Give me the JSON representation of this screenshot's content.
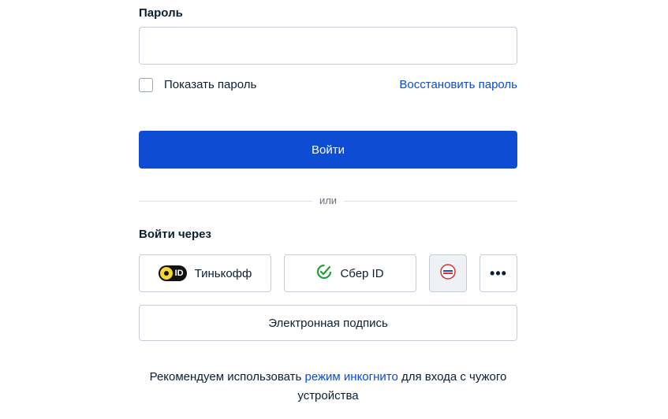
{
  "password": {
    "label": "Пароль",
    "value": "",
    "placeholder": ""
  },
  "show_password": {
    "label": "Показать пароль",
    "checked": false
  },
  "restore_link": "Восстановить пароль",
  "login_button": "Войти",
  "divider_text": "или",
  "login_via": {
    "title": "Войти через",
    "buttons": [
      {
        "label": "Тинькофф",
        "badge": "ID",
        "icon": "tinkoff-id-icon"
      },
      {
        "label": "Сбер ID",
        "icon": "sber-icon"
      },
      {
        "label": "",
        "icon": "gosuslugi-icon"
      },
      {
        "label": "•••",
        "icon": "more-icon"
      }
    ]
  },
  "esign_button": "Электронная подпись",
  "recommendation": {
    "before": "Рекомендуем использовать ",
    "link": "режим инкогнито",
    "after": " для входа с чужого устройства"
  },
  "colors": {
    "primary": "#0d4cd3",
    "text": "#0b1f33",
    "border": "#c7cdd6"
  }
}
